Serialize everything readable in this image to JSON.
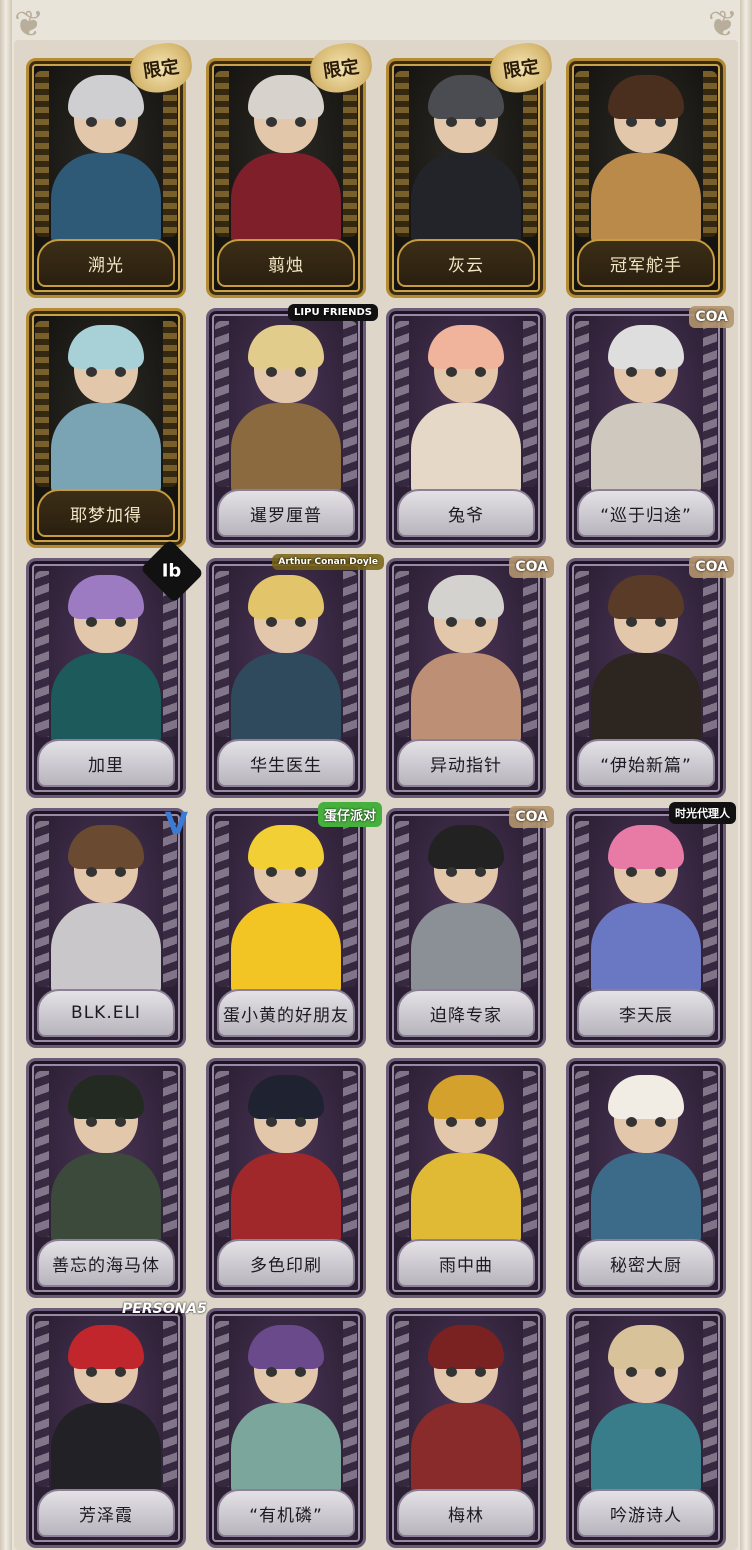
{
  "badge_limited": "限定",
  "cards": [
    {
      "name": "溯光",
      "frame": "gold",
      "badge": "限定",
      "hair": "#cfcfd2",
      "outfit": "#2e5a78"
    },
    {
      "name": "翦烛",
      "frame": "gold",
      "badge": "限定",
      "hair": "#d8d2cd",
      "outfit": "#7e1f29"
    },
    {
      "name": "灰云",
      "frame": "gold",
      "badge": "限定",
      "hair": "#4b4b52",
      "outfit": "#23242a"
    },
    {
      "name": "冠军舵手",
      "frame": "gold",
      "badge": "",
      "hair": "#4a2f1e",
      "outfit": "#b98a4a"
    },
    {
      "name": "耶梦加得",
      "frame": "gold",
      "badge": "",
      "hair": "#a7d1d6",
      "outfit": "#7aa3b3"
    },
    {
      "name": "暹罗厘普",
      "frame": "purple",
      "badge": "LIPU FRIENDS",
      "hair": "#e2cc8b",
      "outfit": "#8a6a3e"
    },
    {
      "name": "兔爷",
      "frame": "purple",
      "badge": "",
      "hair": "#f0b39c",
      "outfit": "#e6d8c6"
    },
    {
      "name": "“巡于归途”",
      "frame": "purple",
      "badge": "COA",
      "hair": "#dedede",
      "outfit": "#cfc8bf"
    },
    {
      "name": "加里",
      "frame": "purple",
      "badge": "Ib",
      "hair": "#9d7bc2",
      "outfit": "#1d5a5c"
    },
    {
      "name": "华生医生",
      "frame": "purple",
      "badge": "Arthur Conan Doyle",
      "hair": "#e2c56a",
      "outfit": "#2f4a5c"
    },
    {
      "name": "异动指针",
      "frame": "purple",
      "badge": "COA",
      "hair": "#d4d2cf",
      "outfit": "#bd8f74"
    },
    {
      "name": "“伊始新篇”",
      "frame": "purple",
      "badge": "COA",
      "hair": "#5a3b28",
      "outfit": "#2c2520"
    },
    {
      "name": "BLK.ELI",
      "frame": "purple",
      "badge": "V",
      "hair": "#6a4a30",
      "outfit": "#c9c7c9"
    },
    {
      "name": "蛋小黄的好朋友",
      "frame": "purple",
      "badge": "蛋仔派对",
      "hair": "#f1cf35",
      "outfit": "#f2c525"
    },
    {
      "name": "迫降专家",
      "frame": "purple",
      "badge": "COA",
      "hair": "#222222",
      "outfit": "#8b8f96"
    },
    {
      "name": "李天辰",
      "frame": "purple",
      "badge": "时光代理人",
      "hair": "#e77ba6",
      "outfit": "#6a78c4"
    },
    {
      "name": "善忘的海马体",
      "frame": "purple",
      "badge": "",
      "hair": "#222a22",
      "outfit": "#3b4a3b"
    },
    {
      "name": "多色印刷",
      "frame": "purple",
      "badge": "",
      "hair": "#1f2230",
      "outfit": "#a0282a"
    },
    {
      "name": "雨中曲",
      "frame": "purple",
      "badge": "",
      "hair": "#d3a12c",
      "outfit": "#e0b935"
    },
    {
      "name": "秘密大厨",
      "frame": "purple",
      "badge": "",
      "hair": "#f1ece4",
      "outfit": "#3c6b8a"
    },
    {
      "name": "芳泽霞",
      "frame": "purple",
      "badge": "PERSONA5",
      "hair": "#c0262c",
      "outfit": "#222226"
    },
    {
      "name": "“有机磷”",
      "frame": "purple",
      "badge": "",
      "hair": "#6b4a8c",
      "outfit": "#7aa69b"
    },
    {
      "name": "梅林",
      "frame": "purple",
      "badge": "",
      "hair": "#7a2222",
      "outfit": "#8a2b2b"
    },
    {
      "name": "吟游诗人",
      "frame": "purple",
      "badge": "",
      "hair": "#d7c29a",
      "outfit": "#3a7d8a"
    }
  ]
}
